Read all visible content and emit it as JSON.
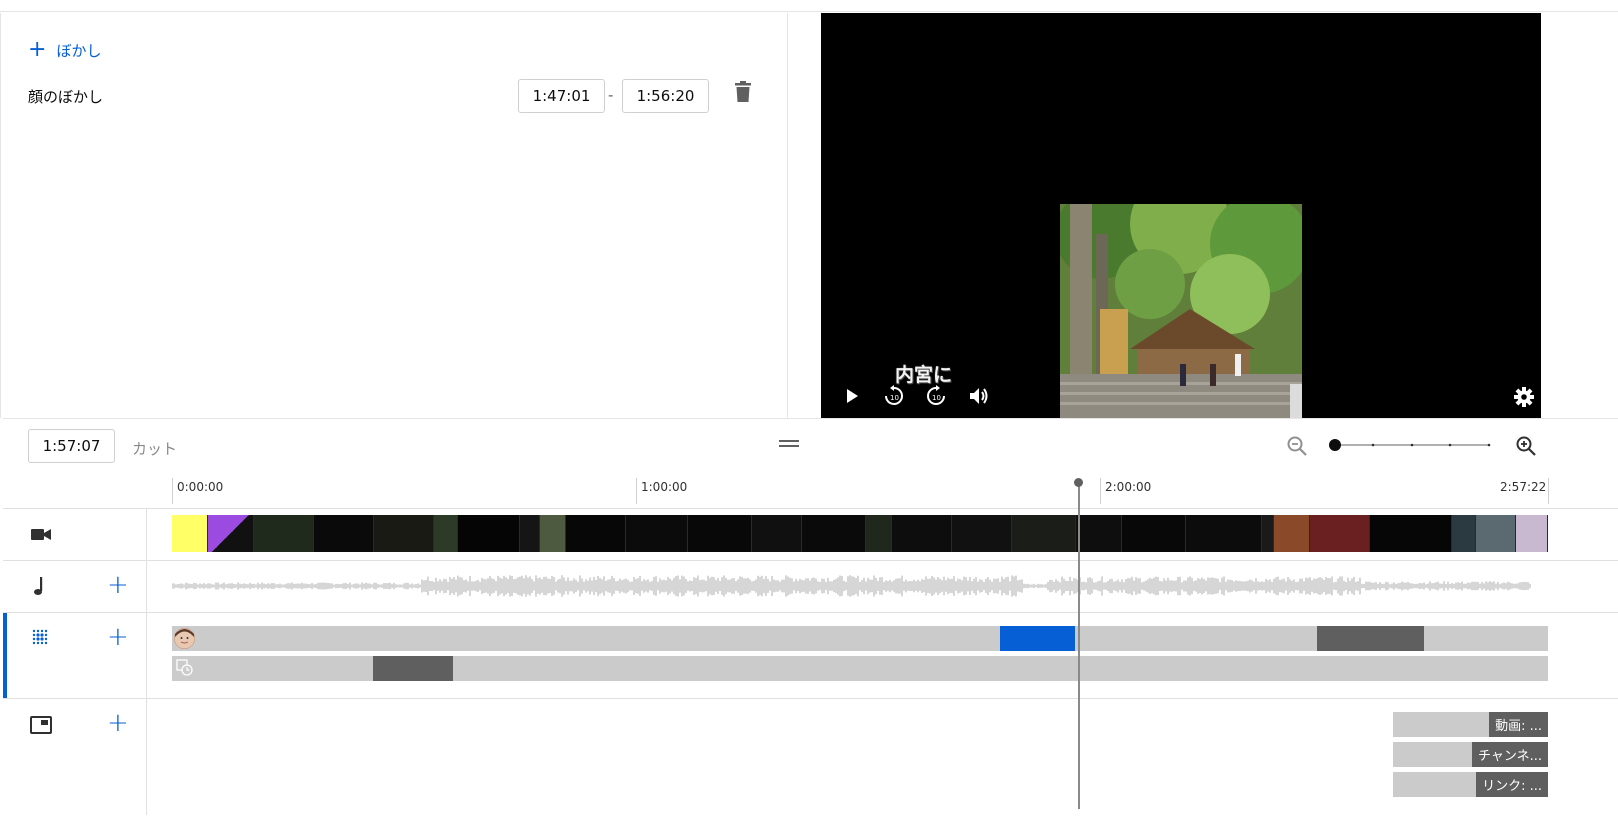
{
  "blur_panel": {
    "add_label": "ぼかし",
    "item": {
      "name": "顔のぼかし",
      "start_time": "1:47:01",
      "separator": "-",
      "end_time": "1:56:20"
    }
  },
  "player": {
    "caption": "内宮に",
    "controls": [
      "play-icon",
      "rewind-10-icon",
      "forward-10-icon",
      "volume-icon",
      "settings-icon"
    ]
  },
  "timeline": {
    "current_time": "1:57:07",
    "cut_label": "カット",
    "ruler": [
      "0:00:00",
      "1:00:00",
      "2:00:00",
      "2:57:22"
    ],
    "playhead_fraction": 0.659,
    "zoom_level": 0,
    "zoom_steps": 5
  },
  "end_cards": [
    {
      "label": "動画: ..."
    },
    {
      "label": "チャンネ..."
    },
    {
      "label": "リンク: ..."
    }
  ],
  "colors": {
    "accent": "#065fd4",
    "selected_segment": "#065fd4",
    "segment": "#5f5f5f",
    "lane": "#cbcbcb"
  }
}
